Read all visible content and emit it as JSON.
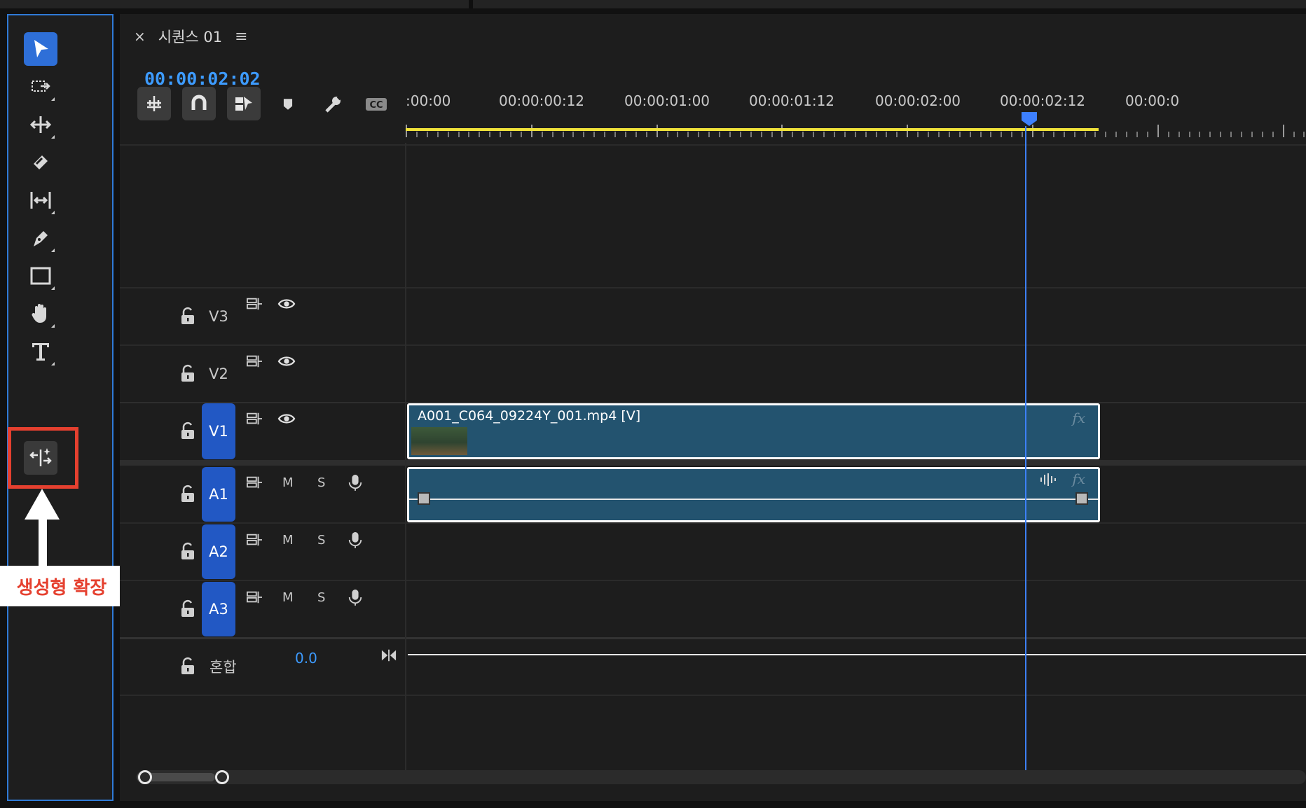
{
  "sequence": {
    "close": "×",
    "title": "시퀀스 01",
    "menu": "≡",
    "timecode": "00:00:02:02"
  },
  "ruler": {
    "labels": [
      ":00:00",
      "00:00:00:12",
      "00:00:01:00",
      "00:00:01:12",
      "00:00:02:00",
      "00:00:02:12",
      "00:00:0"
    ]
  },
  "tools": [
    "selection-tool",
    "track-select-forward-tool",
    "ripple-edit-tool",
    "razor-tool",
    "slip-tool",
    "pen-tool",
    "rectangle-tool",
    "hand-tool",
    "type-tool",
    "generative-extend-tool"
  ],
  "callout": {
    "label": "생성형 확장"
  },
  "tracks": {
    "v3": {
      "name": "V3"
    },
    "v2": {
      "name": "V2"
    },
    "v1": {
      "name": "V1"
    },
    "a1": {
      "name": "A1",
      "m": "M",
      "s": "S"
    },
    "a2": {
      "name": "A2",
      "m": "M",
      "s": "S"
    },
    "a3": {
      "name": "A3",
      "m": "M",
      "s": "S"
    },
    "mix": {
      "name": "혼합",
      "value": "0.0"
    }
  },
  "clips": {
    "video": {
      "name": "A001_C064_09224Y_001.mp4 [V]",
      "fx": "fx"
    },
    "audio": {
      "fx": "fx"
    }
  },
  "colors": {
    "accent": "#3d9bff",
    "selected_track": "#2258c4",
    "clip": "#23536f",
    "work_area": "#efe23a",
    "callout": "#e5402f"
  }
}
